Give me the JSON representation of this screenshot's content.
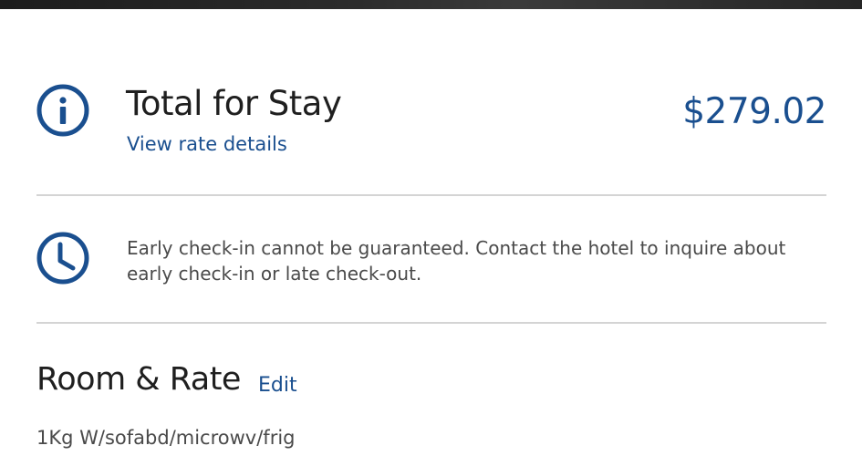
{
  "total": {
    "title": "Total for Stay",
    "rate_link": "View rate details",
    "price": "$279.02",
    "icon": "info-icon"
  },
  "checkin": {
    "icon": "clock-icon",
    "notice": "Early check-in cannot be guaranteed. Contact the hotel to inquire about early check-in or late check-out."
  },
  "room": {
    "title": "Room & Rate",
    "edit_label": "Edit",
    "room_type": "1Kg W/sofabd/microwv/frig"
  },
  "colors": {
    "accent": "#1a4f8f",
    "divider": "#d4d4d4",
    "text_primary": "#1f1f1f",
    "text_secondary": "#4a4a4a"
  }
}
